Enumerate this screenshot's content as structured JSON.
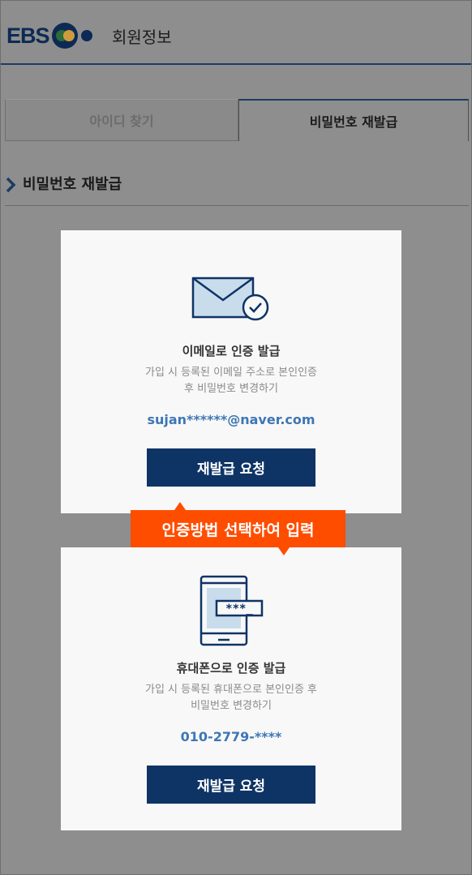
{
  "header": {
    "logo_text": "EBS",
    "title": "회원정보",
    "accent_color": "#1d3c63"
  },
  "tabs": [
    {
      "label": "아이디 찾기",
      "active": false
    },
    {
      "label": "비밀번호 재발급",
      "active": true
    }
  ],
  "section": {
    "title": "비밀번호 재발급",
    "icon": "chevron-right-icon"
  },
  "email_card": {
    "icon": "mail-check-icon",
    "title": "이메일로 인증 발급",
    "desc_line1": "가입 시 등록된 이메일 주소로 본인인증",
    "desc_line2": "후 비밀번호 변경하기",
    "value": "sujan******@naver.com",
    "button_label": "재발급 요청"
  },
  "tooltip": {
    "text": "인증방법 선택하여 입력",
    "color": "#ff4d00"
  },
  "phone_card": {
    "icon": "phone-password-icon",
    "title": "휴대폰으로 인증 발급",
    "desc_line1": "가입 시 등록된 휴대폰으로 본인인증 후",
    "desc_line2": "비밀번호 변경하기",
    "value": "010-2779-****",
    "button_label": "재발급 요청",
    "mask_text": "***_"
  }
}
